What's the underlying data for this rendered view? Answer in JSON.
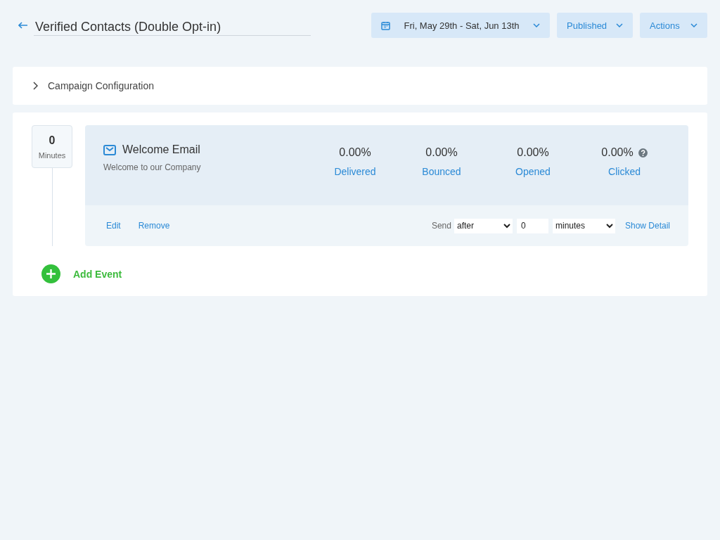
{
  "header": {
    "title": "Verified Contacts (Double Opt-in)",
    "date_range": "Fri, May 29th - Sat, Jun 13th",
    "status": "Published",
    "actions": "Actions"
  },
  "config": {
    "label": "Campaign Configuration",
    "expanded": false
  },
  "timeline": {
    "delay": {
      "value": "0",
      "unit": "Minutes"
    },
    "event": {
      "title": "Welcome Email",
      "subtitle": "Welcome to our Company",
      "stats": [
        {
          "value": "0.00%",
          "label": "Delivered"
        },
        {
          "value": "0.00%",
          "label": "Bounced"
        },
        {
          "value": "0.00%",
          "label": "Opened"
        },
        {
          "value": "0.00%",
          "label": "Clicked"
        }
      ],
      "help_icon": true,
      "links": [
        "Edit",
        "Remove"
      ],
      "send_label": "Send",
      "send_when": "after",
      "send_amount": "0",
      "send_unit": "minutes",
      "detail_link": "Show Detail"
    },
    "add_label": "Add Event"
  }
}
